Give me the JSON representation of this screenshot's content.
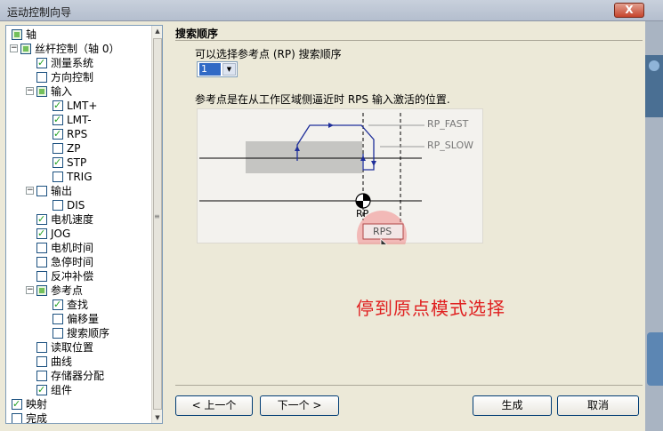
{
  "window": {
    "title": "运动控制向导",
    "close_label": "X"
  },
  "tree": {
    "items": [
      {
        "label": "轴",
        "level": 0,
        "expand": "",
        "check": "part"
      },
      {
        "label": "丝杆控制（轴 0）",
        "level": 1,
        "expand": "−",
        "check": "part"
      },
      {
        "label": "测量系统",
        "level": 2,
        "expand": "",
        "check": "on"
      },
      {
        "label": "方向控制",
        "level": 2,
        "expand": "",
        "check": "off"
      },
      {
        "label": "输入",
        "level": 2,
        "expand": "−",
        "check": "part"
      },
      {
        "label": "LMT+",
        "level": 3,
        "expand": "",
        "check": "on"
      },
      {
        "label": "LMT-",
        "level": 3,
        "expand": "",
        "check": "on"
      },
      {
        "label": "RPS",
        "level": 3,
        "expand": "",
        "check": "on"
      },
      {
        "label": "ZP",
        "level": 3,
        "expand": "",
        "check": "off"
      },
      {
        "label": "STP",
        "level": 3,
        "expand": "",
        "check": "on"
      },
      {
        "label": "TRIG",
        "level": 3,
        "expand": "",
        "check": "off"
      },
      {
        "label": "输出",
        "level": 2,
        "expand": "−",
        "check": "off"
      },
      {
        "label": "DIS",
        "level": 3,
        "expand": "",
        "check": "off"
      },
      {
        "label": "电机速度",
        "level": 2,
        "expand": "",
        "check": "on"
      },
      {
        "label": "JOG",
        "level": 2,
        "expand": "",
        "check": "on"
      },
      {
        "label": "电机时间",
        "level": 2,
        "expand": "",
        "check": "off"
      },
      {
        "label": "急停时间",
        "level": 2,
        "expand": "",
        "check": "off"
      },
      {
        "label": "反冲补偿",
        "level": 2,
        "expand": "",
        "check": "off"
      },
      {
        "label": "参考点",
        "level": 2,
        "expand": "−",
        "check": "part"
      },
      {
        "label": "查找",
        "level": 3,
        "expand": "",
        "check": "on"
      },
      {
        "label": "偏移量",
        "level": 3,
        "expand": "",
        "check": "off"
      },
      {
        "label": "搜索顺序",
        "level": 3,
        "expand": "",
        "check": "off"
      },
      {
        "label": "读取位置",
        "level": 2,
        "expand": "",
        "check": "off"
      },
      {
        "label": "曲线",
        "level": 2,
        "expand": "",
        "check": "off"
      },
      {
        "label": "存储器分配",
        "level": 2,
        "expand": "",
        "check": "off"
      },
      {
        "label": "组件",
        "level": 2,
        "expand": "",
        "check": "on"
      },
      {
        "label": "映射",
        "level": 0,
        "expand": "",
        "check": "on"
      },
      {
        "label": "完成",
        "level": 0,
        "expand": "",
        "check": "off"
      }
    ]
  },
  "main": {
    "section_title": "搜索顺序",
    "select_label": "可以选择参考点 (RP) 搜索顺序",
    "select_value": "1",
    "description": "参考点是在从工作区域侧逼近时 RPS 输入激活的位置.",
    "diagram": {
      "rp_fast": "RP_FAST",
      "rp_slow": "RP_SLOW",
      "rp": "RP",
      "rps": "RPS"
    },
    "caption": "停到原点模式选择"
  },
  "buttons": {
    "prev": "< 上一个",
    "next": "下一个 >",
    "generate": "生成",
    "cancel": "取消"
  },
  "colors": {
    "accent_blue": "#1f2f9a",
    "caption_red": "#e02020",
    "highlight_circle": "#f08a8a"
  }
}
